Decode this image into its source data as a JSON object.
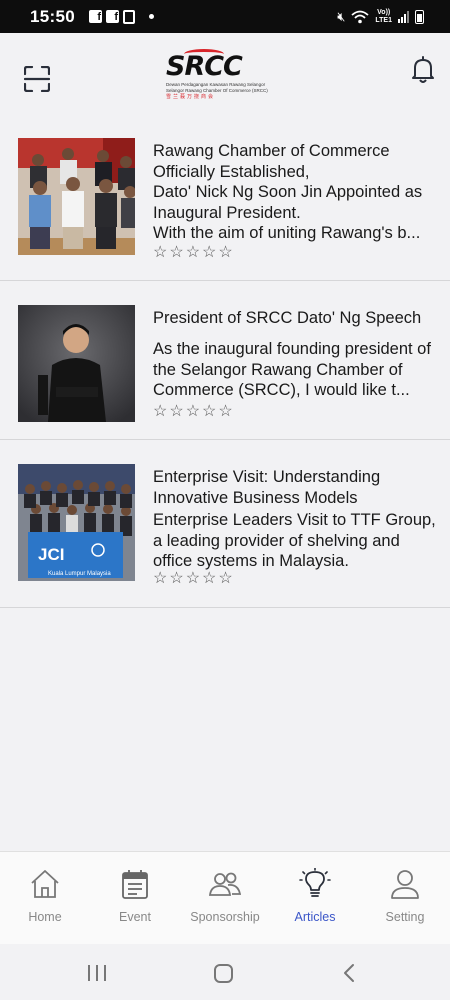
{
  "status_bar": {
    "time": "15:50",
    "network_label_1": "Vo))",
    "network_label_2": "LTE1"
  },
  "header": {
    "logo": {
      "mark": "SRCC",
      "line1": "Dewan Perdagangan Kawasan Rawang Selangor",
      "line2": "Selangor Rawang Chamber Of Commerce (SRCC)",
      "line3": "雪兰莪万挠商会"
    },
    "left_icon": "scan-icon",
    "right_icon": "bell-icon"
  },
  "articles": [
    {
      "title": "Rawang Chamber of Commerce Officially Established,",
      "description": " Dato' Nick Ng Soon Jin Appointed as Inaugural President.\nWith the aim of uniting Rawang's b...",
      "rating": 0,
      "max_rating": 5,
      "thumbnail": "group-photo"
    },
    {
      "title": "President of SRCC Dato' Ng Speech",
      "description": " As the inaugural founding president of the Selangor Rawang Chamber of Commerce (SRCC), I would like t...",
      "rating": 0,
      "max_rating": 5,
      "thumbnail": "portrait-photo"
    },
    {
      "title": "Enterprise Visit: Understanding Innovative Business Models",
      "description": " Enterprise Leaders Visit to TTF Group, a leading provider of shelving and office systems in Malaysia.",
      "rating": 0,
      "max_rating": 5,
      "thumbnail": "jci-group-photo",
      "banner_text": "JCI",
      "banner_subtext": "Kuala Lumpur Malaysia"
    }
  ],
  "bottom_nav": {
    "items": [
      {
        "label": "Home",
        "icon": "home-icon",
        "active": false
      },
      {
        "label": "Event",
        "icon": "calendar-icon",
        "active": false
      },
      {
        "label": "Sponsorship",
        "icon": "people-icon",
        "active": false
      },
      {
        "label": "Articles",
        "icon": "lightbulb-icon",
        "active": true
      },
      {
        "label": "Setting",
        "icon": "user-icon",
        "active": false
      }
    ]
  },
  "colors": {
    "accent": "#3b56c8",
    "brand_red": "#d8262b",
    "background": "#f2f2f4"
  }
}
